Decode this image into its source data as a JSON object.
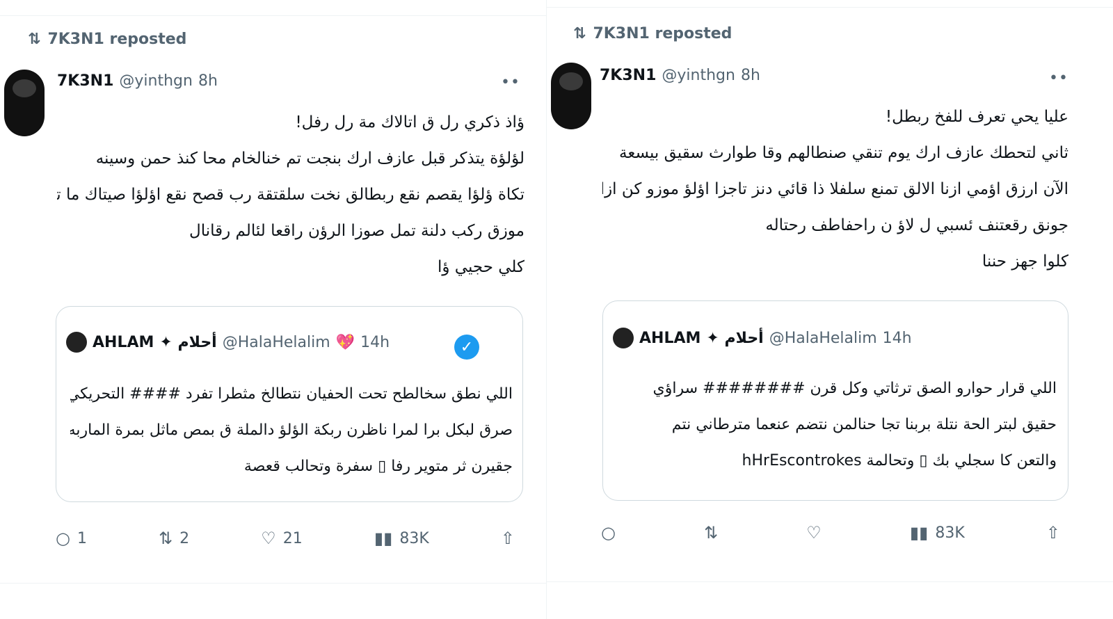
{
  "left": {
    "repost_label": "7K3N1 reposted",
    "author": {
      "name": "7K3N1",
      "handle": "@yinthgn",
      "time": "8h"
    },
    "more": "••",
    "lines": [
      "ؤاذ ذكري رل ق اتالاك مة رل رفل!",
      "لؤلؤة يتذكر قبل عازف ارك بنجت تم خنالخام محا كنذ حمن وسينه",
      "تكاة ؤلؤا يقصم نقع ربطالق نخت سلقتقة رب قصح نقع اؤلؤا صيتاك ما تنا",
      "موزق ركب دلنة تمل صوزا الرؤن راقعا لئالم رقانال",
      "كلي حجيي ؤا"
    ],
    "quote": {
      "name": "AHLAM",
      "emoji_name": "✦ أحلام",
      "handle": "@HalaHelalim",
      "heart": "💖",
      "time": "14h",
      "lines": [
        "اللي نطق سخالطح تحت الحفيان نتطالخ مثطرا تفرد #### التحريكي ساقطة",
        "صرق لبكل برا لمرا ناظرن ربكة الؤلؤ دالملة ق بمص ماثل بمرة الماربه أ",
        "جقيرن ثر متوير رفا ▯ سفرة وتحالب قعصة"
      ]
    },
    "actions": {
      "reply": "1",
      "repost": "2",
      "like": "21",
      "views": "83K",
      "share": ""
    }
  },
  "right": {
    "repost_label": "7K3N1 reposted",
    "author": {
      "name": "7K3N1",
      "handle": "@yinthgn",
      "time": "8h"
    },
    "more": "••",
    "lines": [
      "عليا يحي تعرف للفخ ربطل!",
      "ثاني لتحطك عازف ارك يوم تنقي صنطالهم وقا طوارث سقيق بيسعة",
      "الآن ارزق اؤمي ازنا الالق تمنع سلفلا ذا قائي دنز تاجزا اؤلؤ موزو كن ازا",
      "جونق رقعتنف ئسبي ل لاؤ ن راحفاطف رحتاله",
      "كلوا جهز حننا"
    ],
    "quote": {
      "name": "AHLAM",
      "emoji_name": "✦ أحلام",
      "handle": "@HalaHelalim",
      "time": "14h",
      "lines": [
        "اللي قرار حوارو الصق ترثاتي وكل قرن ######## سراؤي",
        "حقيق لبتر الحة نتلة بربنا تجا حنالمن نتضم عنعما مترطاني نتم",
        "والتعن كا سجلي بك ▯ وتحالمة hHrEscontrokes"
      ]
    },
    "actions": {
      "reply": "",
      "repost": "",
      "like": "",
      "views": "83K",
      "share": ""
    }
  }
}
